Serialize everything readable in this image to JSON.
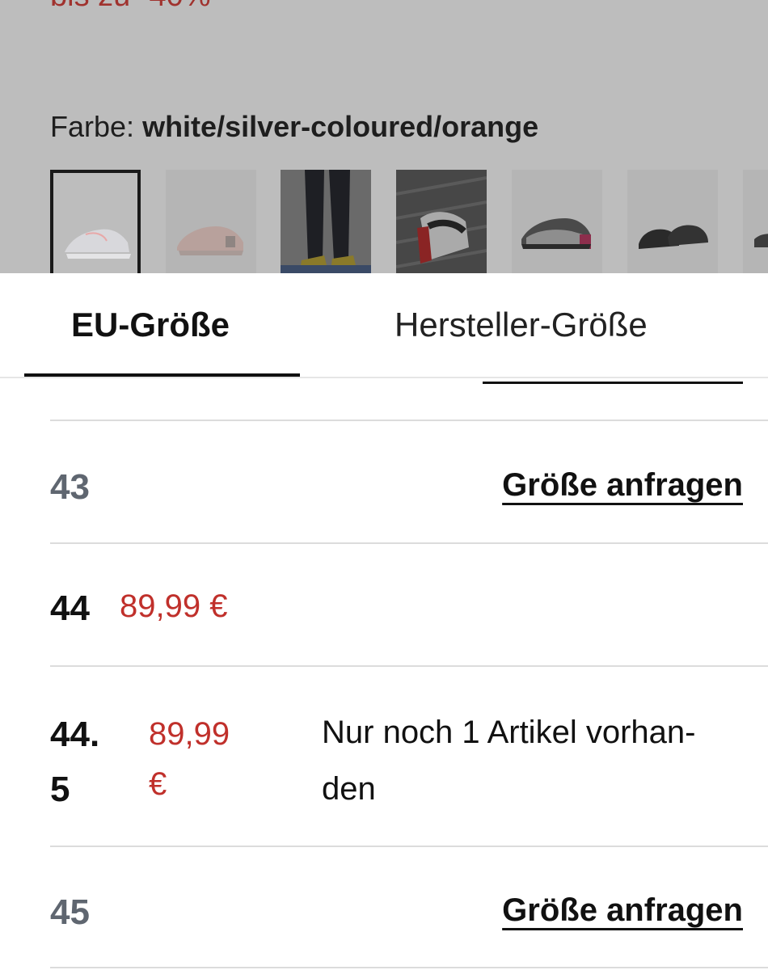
{
  "product": {
    "promo_text": "bis zu -40%",
    "color_label": "Farbe:",
    "color_value": "white/silver-coloured/orange",
    "thumbnails": [
      {
        "icon": "white-sneaker-thumbnail",
        "selected": true
      },
      {
        "icon": "pink-sneaker-thumbnail",
        "selected": false
      },
      {
        "icon": "worn-trousers-thumbnail",
        "selected": false
      },
      {
        "icon": "black-red-sneaker-thumbnail",
        "selected": false
      },
      {
        "icon": "silver-pink-sneaker-thumbnail",
        "selected": false
      },
      {
        "icon": "black-sneaker-thumbnail",
        "selected": false
      },
      {
        "icon": "partial-sneaker-thumbnail",
        "selected": false
      }
    ]
  },
  "size_sheet": {
    "tabs": [
      {
        "label": "EU-Größe",
        "active": true
      },
      {
        "label": "Hersteller-Größe",
        "active": false
      }
    ],
    "rows": [
      {
        "size": "43",
        "available": false,
        "action": "Größe anfragen"
      },
      {
        "size": "44",
        "available": true,
        "price": "89,99 €"
      },
      {
        "size_line1": "44.",
        "size_line2": "5",
        "available": true,
        "price_line1": "89,99",
        "price_line2": "€",
        "stock_line1": "Nur noch 1 Artikel vorhan-",
        "stock_line2": "den"
      },
      {
        "size": "45",
        "available": false,
        "action": "Größe anfragen"
      }
    ]
  },
  "colors": {
    "price_red": "#c0302b",
    "dim_overlay": "#bdbdbd",
    "unavailable_gray": "#5f6670"
  }
}
